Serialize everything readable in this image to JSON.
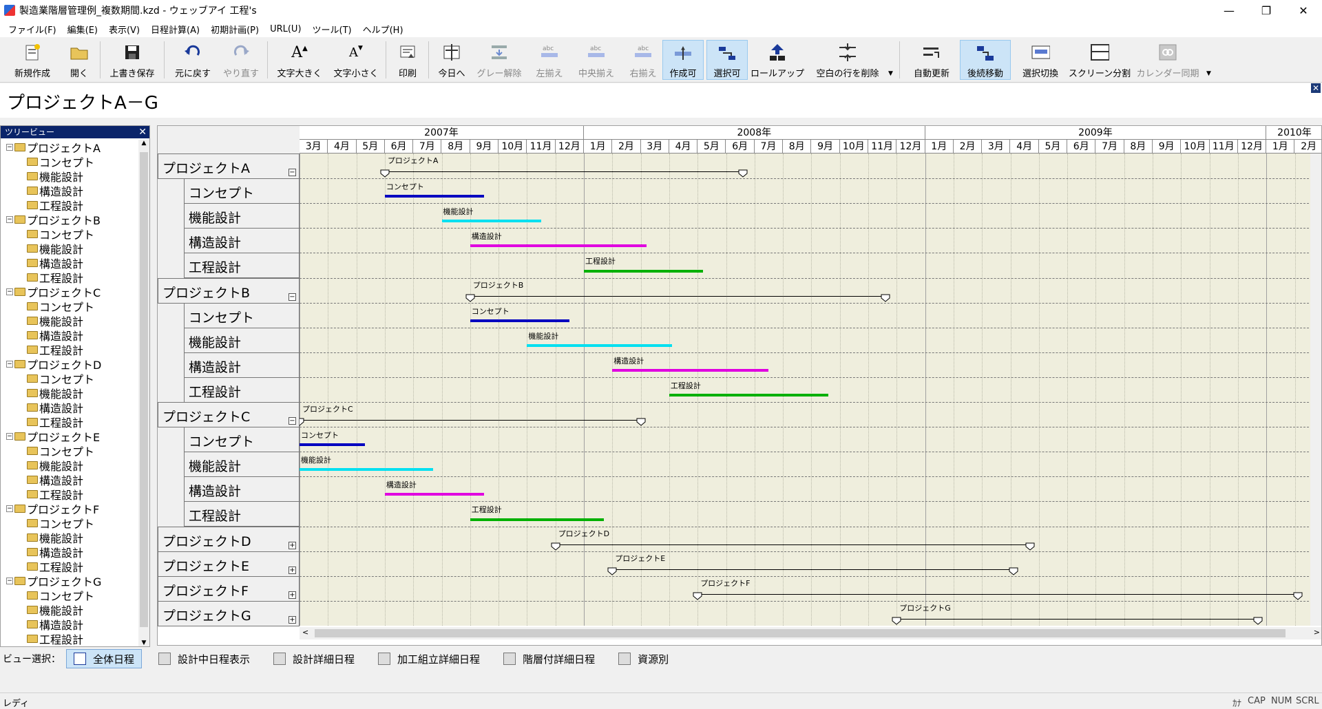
{
  "window": {
    "title": "製造業階層管理例_複数期間.kzd - ウェッブアイ 工程's"
  },
  "menu": [
    "ファイル(F)",
    "編集(E)",
    "表示(V)",
    "日程計算(A)",
    "初期計画(P)",
    "URL(U)",
    "ツール(T)",
    "ヘルプ(H)"
  ],
  "toolbar": {
    "new": "新規作成",
    "open": "開く",
    "save": "上書き保存",
    "undo": "元に戻す",
    "redo": "やり直す",
    "font_up": "文字大きく",
    "font_down": "文字小さく",
    "print": "印刷",
    "today": "今日へ",
    "ungray": "グレー解除",
    "align_left": "左揃え",
    "align_center": "中央揃え",
    "align_right": "右揃え",
    "create": "作成可",
    "select": "選択可",
    "rollup": "ロールアップ",
    "delete_blank": "空白の行を削除",
    "auto_update": "自動更新",
    "follow_move": "後続移動",
    "select_toggle": "選択切換",
    "split": "スクリーン分割",
    "calendar_sync": "カレンダー同期"
  },
  "document": {
    "title": "プロジェクトA－G"
  },
  "tree": {
    "title": "ツリービュー",
    "projects": [
      "プロジェクトA",
      "プロジェクトB",
      "プロジェクトC",
      "プロジェクトD",
      "プロジェクトE",
      "プロジェクトF",
      "プロジェクトG"
    ],
    "tasks": [
      "コンセプト",
      "機能設計",
      "構造設計",
      "工程設計"
    ]
  },
  "gantt": {
    "years": [
      {
        "label": "2007年",
        "months": 10
      },
      {
        "label": "2008年",
        "months": 12
      },
      {
        "label": "2009年",
        "months": 12
      },
      {
        "label": "2010年",
        "months": 2
      }
    ],
    "month_labels": [
      "3月",
      "4月",
      "5月",
      "6月",
      "7月",
      "8月",
      "9月",
      "10月",
      "11月",
      "12月",
      "1月",
      "2月",
      "3月",
      "4月",
      "5月",
      "6月",
      "7月",
      "8月",
      "9月",
      "10月",
      "11月",
      "12月",
      "1月",
      "2月",
      "3月",
      "4月",
      "5月",
      "6月",
      "7月",
      "8月",
      "9月",
      "10月",
      "11月",
      "12月",
      "1月",
      "2月"
    ],
    "colors": {
      "コンセプト": "#0000c0",
      "機能設計": "#00e0f0",
      "構造設計": "#e000e0",
      "工程設計": "#00b000"
    },
    "rows": [
      {
        "label": "プロジェクトA",
        "level": 0,
        "type": "project",
        "expanded": true,
        "start": 3.0,
        "end": 15.6
      },
      {
        "label": "コンセプト",
        "level": 1,
        "type": "task",
        "bar": "コンセプト",
        "start": 3.0,
        "end": 6.5
      },
      {
        "label": "機能設計",
        "level": 1,
        "type": "task",
        "bar": "機能設計",
        "start": 5.0,
        "end": 8.5
      },
      {
        "label": "構造設計",
        "level": 1,
        "type": "task",
        "bar": "構造設計",
        "start": 6.0,
        "end": 12.2
      },
      {
        "label": "工程設計",
        "level": 1,
        "type": "task",
        "bar": "工程設計",
        "start": 10.0,
        "end": 14.2
      },
      {
        "label": "プロジェクトB",
        "level": 0,
        "type": "project",
        "expanded": true,
        "start": 6.0,
        "end": 20.6
      },
      {
        "label": "コンセプト",
        "level": 1,
        "type": "task",
        "bar": "コンセプト",
        "start": 6.0,
        "end": 9.5
      },
      {
        "label": "機能設計",
        "level": 1,
        "type": "task",
        "bar": "機能設計",
        "start": 8.0,
        "end": 13.1
      },
      {
        "label": "構造設計",
        "level": 1,
        "type": "task",
        "bar": "構造設計",
        "start": 11.0,
        "end": 16.5
      },
      {
        "label": "工程設計",
        "level": 1,
        "type": "task",
        "bar": "工程設計",
        "start": 13.0,
        "end": 18.6
      },
      {
        "label": "プロジェクトC",
        "level": 0,
        "type": "project",
        "expanded": true,
        "start": 0.0,
        "end": 12.0
      },
      {
        "label": "コンセプト",
        "level": 1,
        "type": "task",
        "bar": "コンセプト",
        "start": 0.0,
        "end": 2.3
      },
      {
        "label": "機能設計",
        "level": 1,
        "type": "task",
        "bar": "機能設計",
        "start": 0.0,
        "end": 4.7
      },
      {
        "label": "構造設計",
        "level": 1,
        "type": "task",
        "bar": "構造設計",
        "start": 3.0,
        "end": 6.5
      },
      {
        "label": "工程設計",
        "level": 1,
        "type": "task",
        "bar": "工程設計",
        "start": 6.0,
        "end": 10.7
      },
      {
        "label": "プロジェクトD",
        "level": 0,
        "type": "project",
        "expanded": false,
        "start": 9.0,
        "end": 25.7
      },
      {
        "label": "プロジェクトE",
        "level": 0,
        "type": "project",
        "expanded": false,
        "start": 11.0,
        "end": 25.1
      },
      {
        "label": "プロジェクトF",
        "level": 0,
        "type": "project",
        "expanded": false,
        "start": 14.0,
        "end": 35.1
      },
      {
        "label": "プロジェクトG",
        "level": 0,
        "type": "project",
        "expanded": false,
        "start": 21.0,
        "end": 33.7
      }
    ]
  },
  "views": {
    "label": "ビュー選択：",
    "tabs": [
      "全体日程",
      "設計中日程表示",
      "設計詳細日程",
      "加工組立詳細日程",
      "階層付詳細日程",
      "資源別"
    ]
  },
  "status": {
    "text": "レディ",
    "indicators": [
      "ｶﾅ",
      "CAP",
      "NUM",
      "SCRL"
    ]
  }
}
